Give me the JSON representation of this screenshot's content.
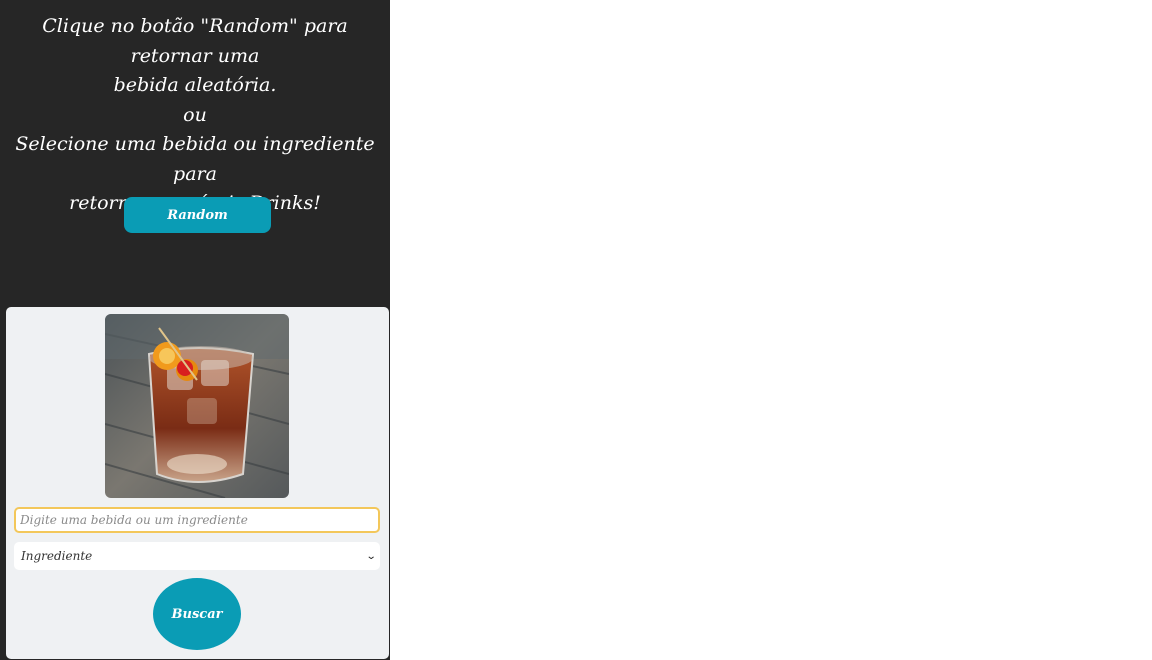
{
  "intro": {
    "line1": "Clique no botão \"Random\" para retornar uma",
    "line2": "bebida aleatória.",
    "line3": "ou",
    "line4": "Selecione uma bebida ou ingrediente para",
    "line5": "retornar possíveis Drinks!"
  },
  "random_button": {
    "label": "Random"
  },
  "search": {
    "placeholder": "Digite uma bebida ou um ingrediente",
    "value": ""
  },
  "type_select": {
    "selected": "Ingrediente",
    "icon": "chevron-down-icon"
  },
  "buscar_button": {
    "label": "Buscar"
  },
  "colors": {
    "panel_bg": "#262626",
    "accent": "#0a9cb5",
    "card_bg": "#eff1f3",
    "input_focus_border": "#f3c75a"
  },
  "image": {
    "subject": "cocktail-glass-with-orange-peel-and-cherry"
  }
}
